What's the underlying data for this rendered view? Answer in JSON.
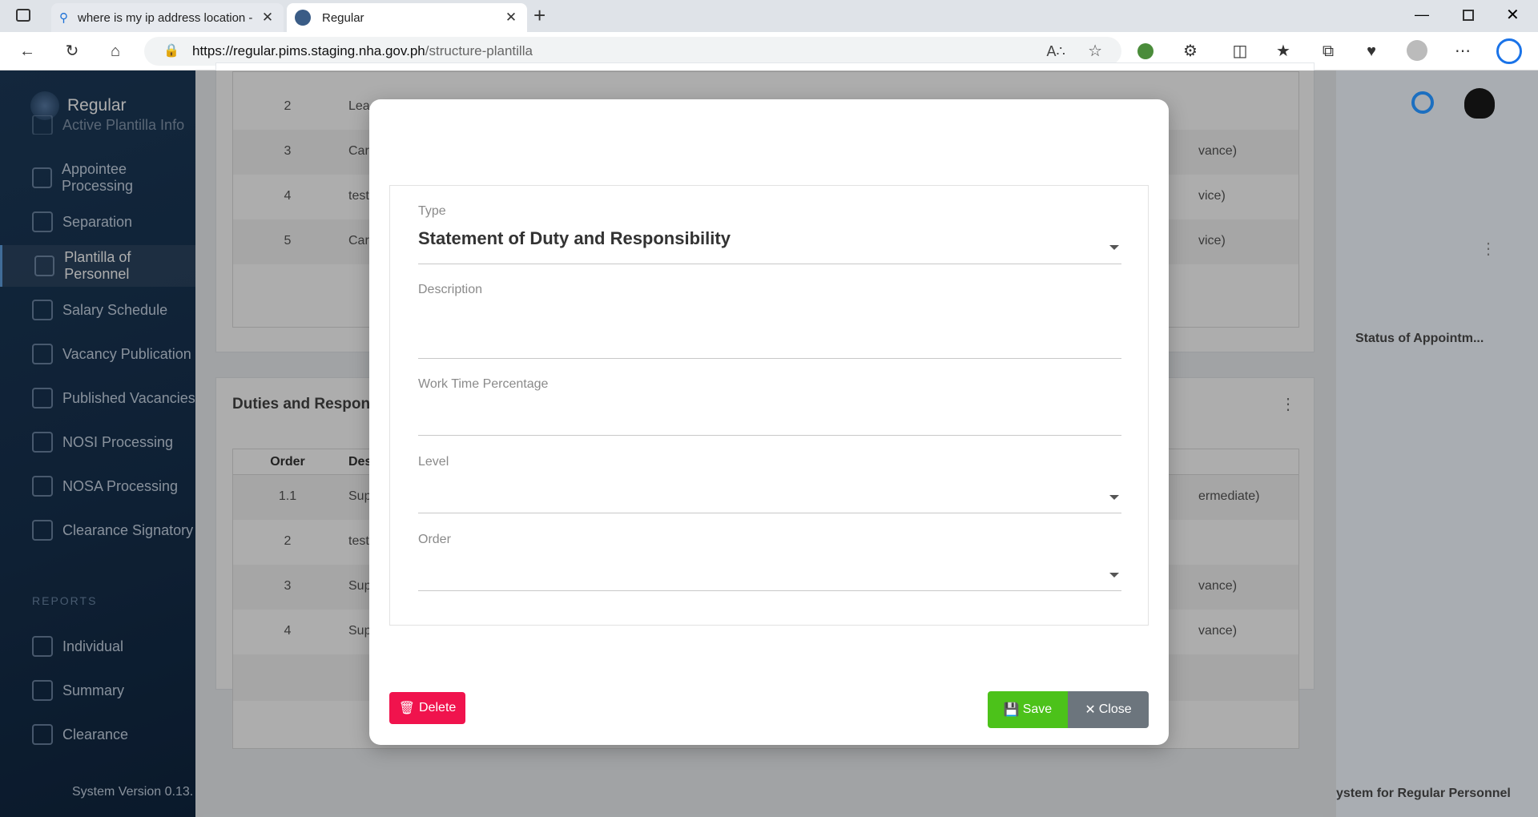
{
  "browser": {
    "tabs": [
      {
        "title": "where is my ip address location -"
      },
      {
        "title": "Regular"
      }
    ],
    "url": {
      "host": "https://regular.pims.staging.nha.gov.ph",
      "path": "/structure-plantilla"
    }
  },
  "sidebar": {
    "app_name": "Regular",
    "items": [
      {
        "label": "Active Plantilla Info"
      },
      {
        "label": "Appointee Processing"
      },
      {
        "label": "Separation"
      },
      {
        "label": "Plantilla of Personnel"
      },
      {
        "label": "Salary Schedule"
      },
      {
        "label": "Vacancy Publication"
      },
      {
        "label": "Published Vacancies"
      },
      {
        "label": "NOSI Processing"
      },
      {
        "label": "NOSA Processing"
      },
      {
        "label": "Clearance Signatory"
      }
    ],
    "reports_heading": "REPORTS",
    "report_items": [
      {
        "label": "Individual"
      },
      {
        "label": "Summary"
      },
      {
        "label": "Clearance"
      }
    ],
    "version": "System Version 0.13."
  },
  "main": {
    "top_table_rows": [
      {
        "order": "2",
        "desc": "Lea",
        "extra": ""
      },
      {
        "order": "3",
        "desc": "Car",
        "extra": "vance)"
      },
      {
        "order": "4",
        "desc": "test",
        "extra": "vice)"
      },
      {
        "order": "5",
        "desc": "Car",
        "extra": "vice)"
      }
    ],
    "duties_title": "Duties and Respon",
    "duties_header": {
      "order": "Order",
      "desc": "Des"
    },
    "duties_rows": [
      {
        "order": "1.1",
        "desc": "Sup",
        "extra": "ermediate)"
      },
      {
        "order": "2",
        "desc": "test",
        "extra": ""
      },
      {
        "order": "3",
        "desc": "Sup",
        "extra": "vance)"
      },
      {
        "order": "4",
        "desc": "Sup",
        "extra": "vance)"
      }
    ],
    "right_column_header": "Status of Appointm...",
    "footer_text": "ystem for Regular Personnel"
  },
  "modal": {
    "type_label": "Type",
    "type_value": "Statement of Duty and Responsibility",
    "description_label": "Description",
    "description_value": "",
    "work_time_label": "Work Time Percentage",
    "work_time_value": "",
    "level_label": "Level",
    "level_value": "",
    "order_label": "Order",
    "order_value": "",
    "delete_label": "Delete",
    "save_label": "Save",
    "close_label": "Close"
  },
  "colors": {
    "delete": "#f0134d",
    "save": "#4cc21a",
    "close": "#6c757d",
    "sidebar": "#16304d"
  }
}
